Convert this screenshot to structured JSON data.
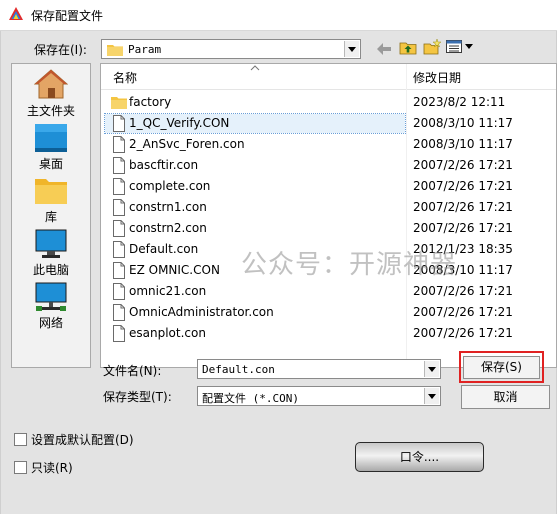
{
  "window": {
    "title": "保存配置文件"
  },
  "save_in": {
    "label": "保存在(I):",
    "value": "Param"
  },
  "places": [
    {
      "label": "主文件夹",
      "icon": "home-icon"
    },
    {
      "label": "桌面",
      "icon": "desktop-icon"
    },
    {
      "label": "库",
      "icon": "library-folder-icon"
    },
    {
      "label": "此电脑",
      "icon": "computer-icon"
    },
    {
      "label": "网络",
      "icon": "network-icon"
    }
  ],
  "list": {
    "col_name": "名称",
    "col_date": "修改日期",
    "items": [
      {
        "name": "factory",
        "date": "2023/8/2 12:11",
        "type": "folder"
      },
      {
        "name": "1_QC_Verify.CON",
        "date": "2008/3/10 11:17",
        "type": "file"
      },
      {
        "name": "2_AnSvc_Foren.con",
        "date": "2008/3/10 11:17",
        "type": "file"
      },
      {
        "name": "bascftir.con",
        "date": "2007/2/26 17:21",
        "type": "file"
      },
      {
        "name": "complete.con",
        "date": "2007/2/26 17:21",
        "type": "file"
      },
      {
        "name": "constrn1.con",
        "date": "2007/2/26 17:21",
        "type": "file"
      },
      {
        "name": "constrn2.con",
        "date": "2007/2/26 17:21",
        "type": "file"
      },
      {
        "name": "Default.con",
        "date": "2012/1/23 18:35",
        "type": "file"
      },
      {
        "name": "EZ OMNIC.CON",
        "date": "2008/3/10 11:17",
        "type": "file"
      },
      {
        "name": "omnic21.con",
        "date": "2007/2/26 17:21",
        "type": "file"
      },
      {
        "name": "OmnicAdministrator.con",
        "date": "2007/2/26 17:21",
        "type": "file"
      },
      {
        "name": "esanplot.con",
        "date": "2007/2/26 17:21",
        "type": "file"
      }
    ]
  },
  "filename": {
    "label": "文件名(N):",
    "value": "Default.con"
  },
  "filetype": {
    "label": "保存类型(T):",
    "value": "配置文件 (*.CON)"
  },
  "buttons": {
    "save": "保存(S)",
    "cancel": "取消",
    "ok": "口令...."
  },
  "options": {
    "set_default": "设置成默认配置(D)",
    "readonly": "只读(R)"
  },
  "watermark": "公众号：开源神器",
  "colors": {
    "selection": "#e5f1fb",
    "highlight_border": "#e02222",
    "folder_yellow": "#f4c542"
  }
}
